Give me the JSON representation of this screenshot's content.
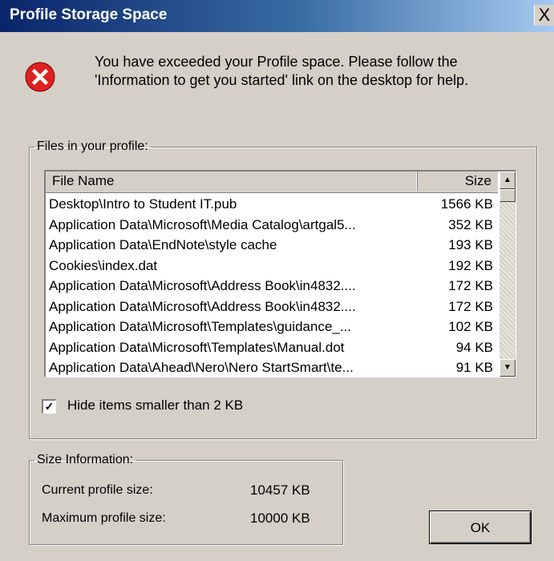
{
  "window": {
    "title": "Profile Storage Space",
    "close_glyph": "X"
  },
  "icons": {
    "error": "error-icon",
    "close": "close-icon",
    "scroll_up": "scroll-up-arrow-icon",
    "scroll_down": "scroll-down-arrow-icon",
    "checkmark": "checkmark-icon"
  },
  "message": {
    "line1": "You have exceeded your Profile space. Please follow the",
    "line2": "'Information to get you started' link on the desktop for help."
  },
  "files_group": {
    "legend": "Files in your profile:",
    "columns": {
      "name": "File Name",
      "size": "Size"
    },
    "rows": [
      {
        "name": "Desktop\\Intro to Student IT.pub",
        "size": "1566 KB"
      },
      {
        "name": "Application Data\\Microsoft\\Media Catalog\\artgal5...",
        "size": "352 KB"
      },
      {
        "name": "Application Data\\EndNote\\style cache",
        "size": "193 KB"
      },
      {
        "name": "Cookies\\index.dat",
        "size": "192 KB"
      },
      {
        "name": "Application Data\\Microsoft\\Address Book\\in4832....",
        "size": "172 KB"
      },
      {
        "name": "Application Data\\Microsoft\\Address Book\\in4832....",
        "size": "172 KB"
      },
      {
        "name": "Application Data\\Microsoft\\Templates\\guidance_...",
        "size": "102 KB"
      },
      {
        "name": "Application Data\\Microsoft\\Templates\\Manual.dot",
        "size": "94 KB"
      },
      {
        "name": "Application Data\\Ahead\\Nero\\Nero StartSmart\\te...",
        "size": "91 KB"
      }
    ]
  },
  "hide_small": {
    "checked": true,
    "check_glyph": "✓",
    "label": "Hide items smaller than 2 KB"
  },
  "size_group": {
    "legend": "Size Information:",
    "current_label": "Current profile size:",
    "current_value": "10457 KB",
    "max_label": "Maximum profile size:",
    "max_value": "10000 KB"
  },
  "ok_button": {
    "label": "OK"
  },
  "colors": {
    "title_bar_start": "#0a246a",
    "title_bar_end": "#a6caf0",
    "dialog_face": "#d4d0c8",
    "error_red": "#e02020"
  }
}
